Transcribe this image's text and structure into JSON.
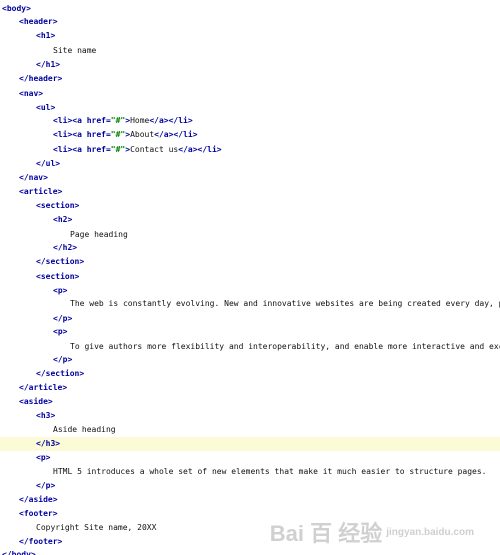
{
  "colors": {
    "tag": "#0000a0",
    "attribute_value": "#008000",
    "text": "#111111",
    "current_line_highlight": "#fbfbd6"
  },
  "code_lines": [
    [
      {
        "t": "<body>",
        "c": "tag"
      }
    ],
    [
      {
        "t": "<header>",
        "c": "tag"
      }
    ],
    [
      {
        "t": "<h1>",
        "c": "tag"
      }
    ],
    [
      {
        "t": "Site name",
        "c": "txt"
      }
    ],
    [
      {
        "t": "</h1>",
        "c": "tag"
      }
    ],
    [
      {
        "t": "</header>",
        "c": "tag"
      }
    ],
    [
      {
        "t": "<nav>",
        "c": "tag"
      }
    ],
    [
      {
        "t": "<ul>",
        "c": "tag"
      }
    ],
    [
      {
        "t": "<li>",
        "c": "tag"
      },
      {
        "t": "<a href=",
        "c": "tag"
      },
      {
        "t": "\"#\"",
        "c": "val"
      },
      {
        "t": ">",
        "c": "tag"
      },
      {
        "t": "Home",
        "c": "txt"
      },
      {
        "t": "</a>",
        "c": "tag"
      },
      {
        "t": "</li>",
        "c": "tag"
      }
    ],
    [
      {
        "t": "<li>",
        "c": "tag"
      },
      {
        "t": "<a href=",
        "c": "tag"
      },
      {
        "t": "\"#\"",
        "c": "val"
      },
      {
        "t": ">",
        "c": "tag"
      },
      {
        "t": "About",
        "c": "txt"
      },
      {
        "t": "</a>",
        "c": "tag"
      },
      {
        "t": "</li>",
        "c": "tag"
      }
    ],
    [
      {
        "t": "<li>",
        "c": "tag"
      },
      {
        "t": "<a href=",
        "c": "tag"
      },
      {
        "t": "\"#\"",
        "c": "val"
      },
      {
        "t": ">",
        "c": "tag"
      },
      {
        "t": "Contact us",
        "c": "txt"
      },
      {
        "t": "</a>",
        "c": "tag"
      },
      {
        "t": "</li>",
        "c": "tag"
      }
    ],
    [
      {
        "t": "</ul>",
        "c": "tag"
      }
    ],
    [
      {
        "t": "</nav>",
        "c": "tag"
      }
    ],
    [
      {
        "t": "<article>",
        "c": "tag"
      }
    ],
    [
      {
        "t": "<section>",
        "c": "tag"
      }
    ],
    [
      {
        "t": "<h2>",
        "c": "tag"
      }
    ],
    [
      {
        "t": "Page heading",
        "c": "txt"
      }
    ],
    [
      {
        "t": "</h2>",
        "c": "tag"
      }
    ],
    [
      {
        "t": "</section>",
        "c": "tag"
      }
    ],
    [
      {
        "t": "<section>",
        "c": "tag"
      }
    ],
    [
      {
        "t": "<p>",
        "c": "tag"
      }
    ],
    [
      {
        "t": "The web is constantly evolving. New and innovative websites are being created every day, pushing the",
        "c": "txt"
      }
    ],
    [
      {
        "t": "</p>",
        "c": "tag"
      }
    ],
    [
      {
        "t": "<p>",
        "c": "tag"
      }
    ],
    [
      {
        "t": "To give authors more flexibility and interoperability, and enable more interactive and exciting webs",
        "c": "txt"
      }
    ],
    [
      {
        "t": "</p>",
        "c": "tag"
      }
    ],
    [
      {
        "t": "</section>",
        "c": "tag"
      }
    ],
    [
      {
        "t": "</article>",
        "c": "tag"
      }
    ],
    [
      {
        "t": "<aside>",
        "c": "tag"
      }
    ],
    [
      {
        "t": "<h3>",
        "c": "tag"
      }
    ],
    [
      {
        "t": "Aside heading",
        "c": "txt"
      }
    ],
    [
      {
        "t": "</h3>",
        "c": "tag"
      }
    ],
    [
      {
        "t": "<p>",
        "c": "tag"
      }
    ],
    [
      {
        "t": "HTML 5 introduces a whole set of new elements that make it much easier to structure pages.",
        "c": "txt"
      }
    ],
    [
      {
        "t": "</p>",
        "c": "tag"
      }
    ],
    [
      {
        "t": "</aside>",
        "c": "tag"
      }
    ],
    [
      {
        "t": "<footer>",
        "c": "tag"
      }
    ],
    [
      {
        "t": "Copyright Site name, 20XX",
        "c": "txt"
      }
    ],
    [
      {
        "t": "</footer>",
        "c": "tag"
      }
    ],
    [
      {
        "t": "</body>",
        "c": "tag"
      }
    ]
  ],
  "watermark": {
    "text": "Bai  百 经验",
    "sub": "jingyan.baidu.com"
  }
}
